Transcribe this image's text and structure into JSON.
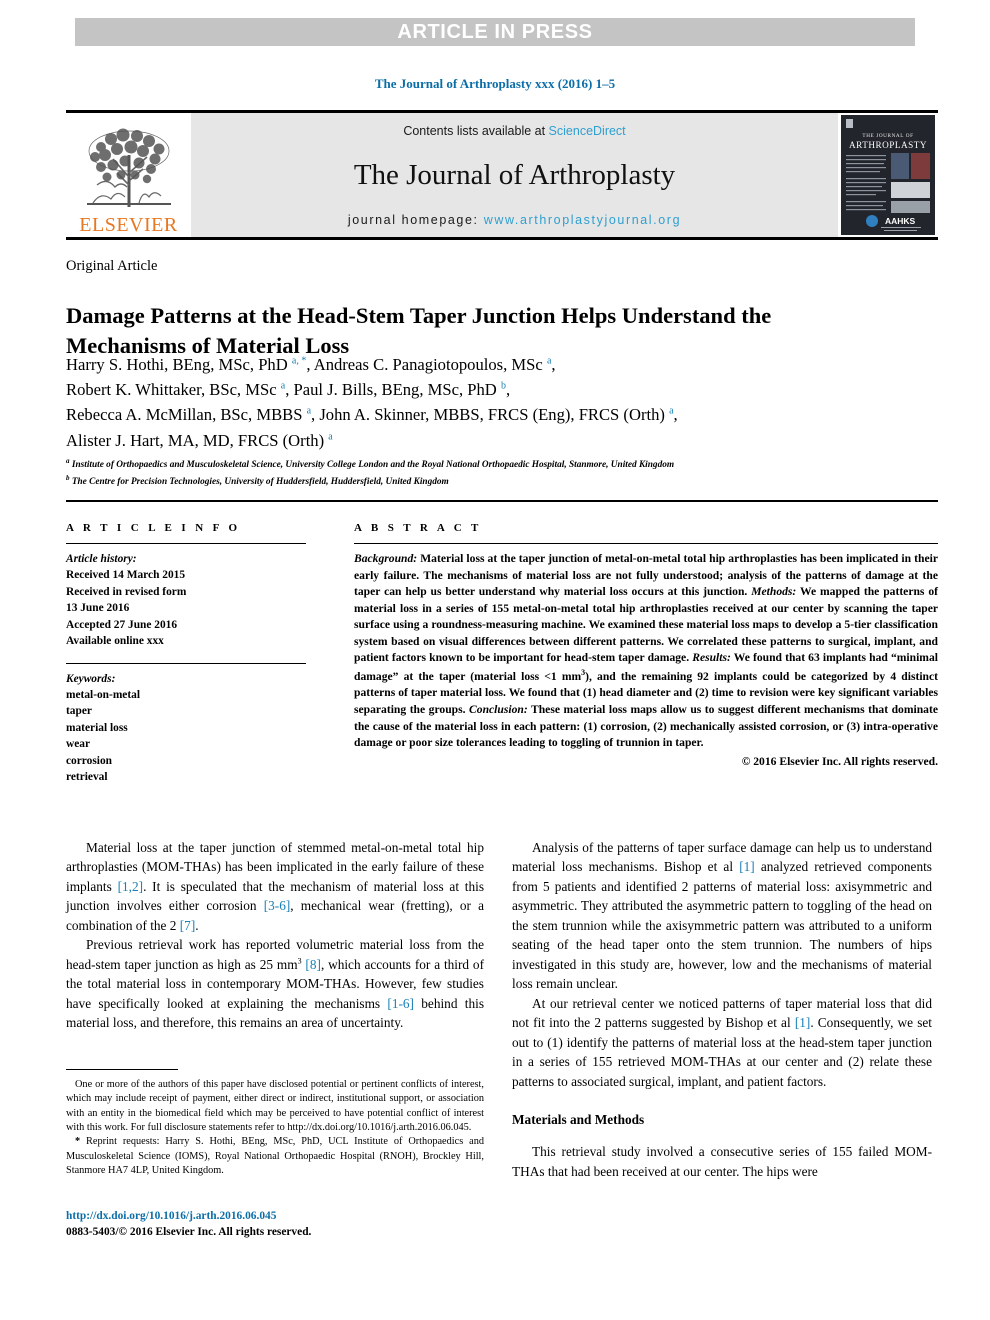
{
  "banner": {
    "text": "ARTICLE IN PRESS"
  },
  "running_head": "The Journal of Arthroplasty xxx (2016) 1–5",
  "masthead": {
    "contents_prefix": "Contents lists available at ",
    "contents_link": "ScienceDirect",
    "journal_title": "The Journal of Arthroplasty",
    "homepage_prefix": "journal homepage: ",
    "homepage_url": "www.arthroplastyjournal.org",
    "publisher_logo": "ELSEVIER",
    "cover": {
      "line1": "THE JOURNAL OF",
      "line2": "ARTHROPLASTY",
      "society": "AAHKS",
      "society_sub": "AMERICAN ASSOCIATION OF HIP AND KNEE SURGEONS"
    }
  },
  "article": {
    "type": "Original Article",
    "title": "Damage Patterns at the Head-Stem Taper Junction Helps Understand the Mechanisms of Material Loss",
    "authors_html": "Harry S. Hothi, BEng, MSc, PhD <sup>a, *</sup>, Andreas C. Panagiotopoulos, MSc <sup>a</sup>,<br>Robert K. Whittaker, BSc, MSc <sup>a</sup>, Paul J. Bills, BEng, MSc, PhD <sup>b</sup>,<br>Rebecca A. McMillan, BSc, MBBS <sup>a</sup>, John A. Skinner, MBBS, FRCS (Eng), FRCS (Orth) <sup>a</sup>,<br>Alister J. Hart, MA, MD, FRCS (Orth) <sup>a</sup>",
    "affiliations": [
      {
        "marker": "a",
        "text": "Institute of Orthopaedics and Musculoskeletal Science, University College London and the Royal National Orthopaedic Hospital, Stanmore, United Kingdom"
      },
      {
        "marker": "b",
        "text": "The Centre for Precision Technologies, University of Huddersfield, Huddersfield, United Kingdom"
      }
    ]
  },
  "info": {
    "heading": "A R T I C L E    I N F O",
    "history_label": "Article history:",
    "history_lines": [
      "Received 14 March 2015",
      "Received in revised form",
      "13 June 2016",
      "Accepted 27 June 2016",
      "Available online xxx"
    ],
    "keywords_label": "Keywords:",
    "keywords": [
      "metal-on-metal",
      "taper",
      "material loss",
      "wear",
      "corrosion",
      "retrieval"
    ]
  },
  "abstract": {
    "heading": "A B S T R A C T",
    "background_label": "Background:",
    "background_text": " Material loss at the taper junction of metal-on-metal total hip arthroplasties has been implicated in their early failure. The mechanisms of material loss are not fully understood; analysis of the patterns of damage at the taper can help us better understand why material loss occurs at this junction.",
    "methods_label": "Methods:",
    "methods_text": " We mapped the patterns of material loss in a series of 155 metal-on-metal total hip arthroplasties received at our center by scanning the taper surface using a roundness-measuring machine. We examined these material loss maps to develop a 5-tier classification system based on visual differences between different patterns. We correlated these patterns to surgical, implant, and patient factors known to be important for head-stem taper damage.",
    "results_label": "Results:",
    "results_text_1": " We found that 63 implants had “minimal damage” at the taper (material loss <1 mm",
    "results_sup": "3",
    "results_text_2": "), and the remaining 92 implants could be categorized by 4 distinct patterns of taper material loss. We found that (1) head diameter and (2) time to revision were key significant variables separating the groups.",
    "conclusion_label": "Conclusion:",
    "conclusion_text": " These material loss maps allow us to suggest different mechanisms that dominate the cause of the material loss in each pattern: (1) corrosion, (2) mechanically assisted corrosion, or (3) intra-operative damage or poor size tolerances leading to toggling of trunnion in taper.",
    "copyright": "© 2016 Elsevier Inc. All rights reserved."
  },
  "body": {
    "left": {
      "p1_a": "Material loss at the taper junction of stemmed metal-on-metal total hip arthroplasties (MOM-THAs) has been implicated in the early failure of these implants ",
      "p1_ref1": "[1,2]",
      "p1_b": ". It is speculated that the mechanism of material loss at this junction involves either corrosion ",
      "p1_ref2": "[3-6]",
      "p1_c": ", mechanical wear (fretting), or a combination of the 2 ",
      "p1_ref3": "[7]",
      "p1_d": ".",
      "p2_a": "Previous retrieval work has reported volumetric material loss from the head-stem taper junction as high as 25 mm",
      "p2_sup": "3",
      "p2_ref1": "[8]",
      "p2_b": ", which accounts for a third of the total material loss in contemporary MOM-THAs. However, few studies have specifically looked at explaining the mechanisms ",
      "p2_ref2": "[1-6]",
      "p2_c": " behind this material loss, and therefore, this remains an area of uncertainty."
    },
    "right": {
      "p1_a": "Analysis of the patterns of taper surface damage can help us to understand material loss mechanisms. Bishop et al ",
      "p1_ref1": "[1]",
      "p1_b": " analyzed retrieved components from 5 patients and identified 2 patterns of material loss: axisymmetric and asymmetric. They attributed the asymmetric pattern to toggling of the head on the stem trunnion while the axisymmetric pattern was attributed to a uniform seating of the head taper onto the stem trunnion. The numbers of hips investigated in this study are, however, low and the mechanisms of material loss remain unclear.",
      "p2_a": "At our retrieval center we noticed patterns of taper material loss that did not fit into the 2 patterns suggested by Bishop et al ",
      "p2_ref1": "[1]",
      "p2_b": ". Consequently, we set out to (1) identify the patterns of material loss at the head-stem taper junction in a series of 155 retrieved MOM-THAs at our center and (2) relate these patterns to associated surgical, implant, and patient factors.",
      "subhead": "Materials and Methods",
      "p3": "This retrieval study involved a consecutive series of 155 failed MOM-THAs that had been received at our center. The hips were"
    }
  },
  "footnotes": {
    "disclosure_a": "One or more of the authors of this paper have disclosed potential or pertinent conflicts of interest, which may include receipt of payment, either direct or indirect, institutional support, or association with an entity in the biomedical field which may be perceived to have potential conflict of interest with this work. For full disclosure statements refer to ",
    "disclosure_link": "http://dx.doi.org/10.1016/j.arth.2016.06.045",
    "disclosure_b": ".",
    "reprint_marker": "*",
    "reprint": " Reprint requests: Harry S. Hothi, BEng, MSc, PhD, UCL Institute of Orthopaedics and Musculoskeletal Science (IOMS), Royal National Orthopaedic Hospital (RNOH), Brockley Hill, Stanmore HA7 4LP, United Kingdom."
  },
  "imprint": {
    "doi": "http://dx.doi.org/10.1016/j.arth.2016.06.045",
    "issn_line": "0883-5403/© 2016 Elsevier Inc. All rights reserved."
  },
  "colors": {
    "link_blue": "#0b6ea8",
    "ref_blue": "#1a7fb5",
    "sciencedirect_blue": "#2f9fd0",
    "banner_gray": "#c4c4c4",
    "masthead_gray": "#e6e6e6",
    "elsevier_orange": "#e87722"
  }
}
